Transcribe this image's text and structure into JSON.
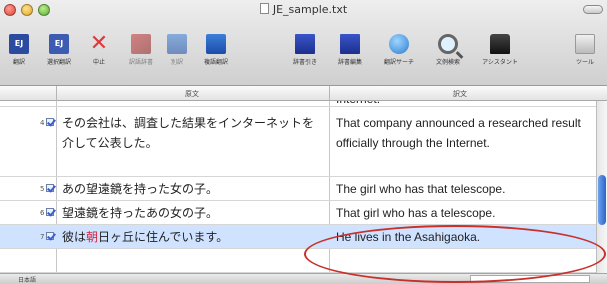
{
  "window": {
    "title": "JE_sample.txt"
  },
  "toolbar": {
    "items": [
      {
        "label": "翻訳",
        "icon": "translate-ej-icon",
        "glyph": "EJ"
      },
      {
        "label": "選択翻訳",
        "icon": "selection-translate-icon",
        "glyph": "EJ"
      },
      {
        "label": "中止",
        "icon": "stop-icon",
        "glyph": "✕"
      },
      {
        "label": "訳語辞書",
        "icon": "dictionary-icon",
        "glyph": ""
      },
      {
        "label": "別訳",
        "icon": "alternate-translation-icon",
        "glyph": ""
      },
      {
        "label": "複語翻訳",
        "icon": "multi-translation-icon",
        "glyph": ""
      },
      {
        "label": "辞書引き",
        "icon": "dictionary-lookup-icon",
        "glyph": ""
      },
      {
        "label": "辞書編集",
        "icon": "dictionary-edit-icon",
        "glyph": ""
      },
      {
        "label": "翻訳サーチ",
        "icon": "translation-search-icon",
        "glyph": ""
      },
      {
        "label": "文例検索",
        "icon": "example-search-icon",
        "glyph": ""
      },
      {
        "label": "アシスタント",
        "icon": "assistant-icon",
        "glyph": ""
      },
      {
        "label": "ツール",
        "icon": "tools-icon",
        "glyph": ""
      }
    ]
  },
  "columns": {
    "source": "原文",
    "translation": "訳文"
  },
  "rows": [
    {
      "num": "",
      "ja": "",
      "en": "Internet."
    },
    {
      "num": "4",
      "ja": "その会社は、調査した結果をインターネットを介して公表した。",
      "en": "That company announced a researched result officially through the Internet."
    },
    {
      "num": "5",
      "ja": "あの望遠鏡を持った女の子。",
      "en": "The girl who has that telescope."
    },
    {
      "num": "6",
      "ja": "望遠鏡を持ったあの女の子。",
      "en": "That girl who has a telescope."
    },
    {
      "num": "7",
      "ja_pre": "彼は",
      "ja_hi": "朝",
      "ja_post": "日ヶ丘に住んでいます。",
      "en": "He lives in the Asahigaoka."
    }
  ],
  "status": {
    "left": "日本語"
  },
  "colors": {
    "selection": "#cfe2ff",
    "annotation": "#c8302b",
    "highlight_text": "#d8253a"
  }
}
